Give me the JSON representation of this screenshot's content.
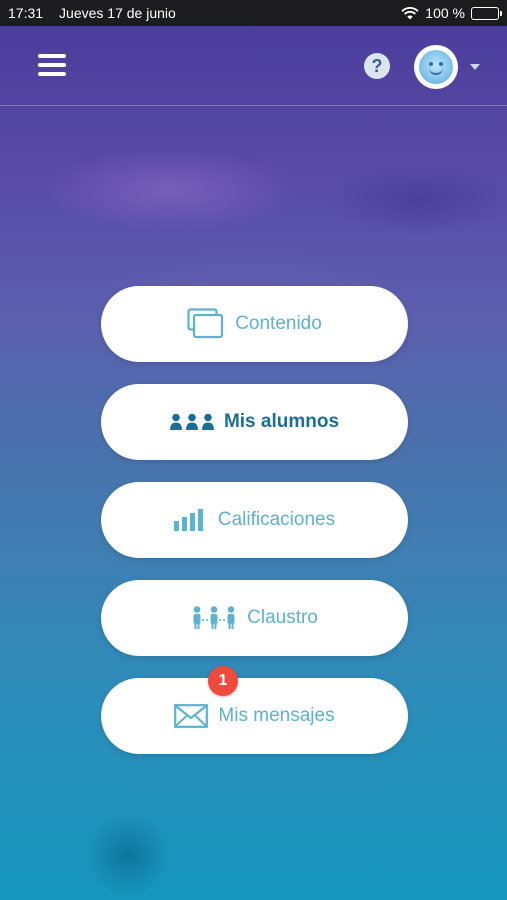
{
  "status_bar": {
    "time": "17:31",
    "date": "Jueves 17 de junio",
    "battery": "100 %"
  },
  "header": {
    "menu_icon": "hamburger-icon",
    "help_icon": "question-circle-icon",
    "help_glyph": "?",
    "avatar_icon": "smiley-avatar-icon",
    "dropdown_icon": "caret-down-icon"
  },
  "menu": {
    "items": [
      {
        "label": "Contenido",
        "icon": "windows-stack-icon",
        "active": false
      },
      {
        "label": "Mis alumnos",
        "icon": "students-group-icon",
        "active": true
      },
      {
        "label": "Calificaciones",
        "icon": "bar-chart-icon",
        "active": false
      },
      {
        "label": "Claustro",
        "icon": "staff-group-icon",
        "active": false
      },
      {
        "label": "Mis mensajes",
        "icon": "envelope-icon",
        "active": false,
        "badge": "1"
      }
    ]
  },
  "colors": {
    "button_text": "#5bb3cf",
    "button_text_active": "#1b6f96",
    "badge": "#f04a3c"
  }
}
